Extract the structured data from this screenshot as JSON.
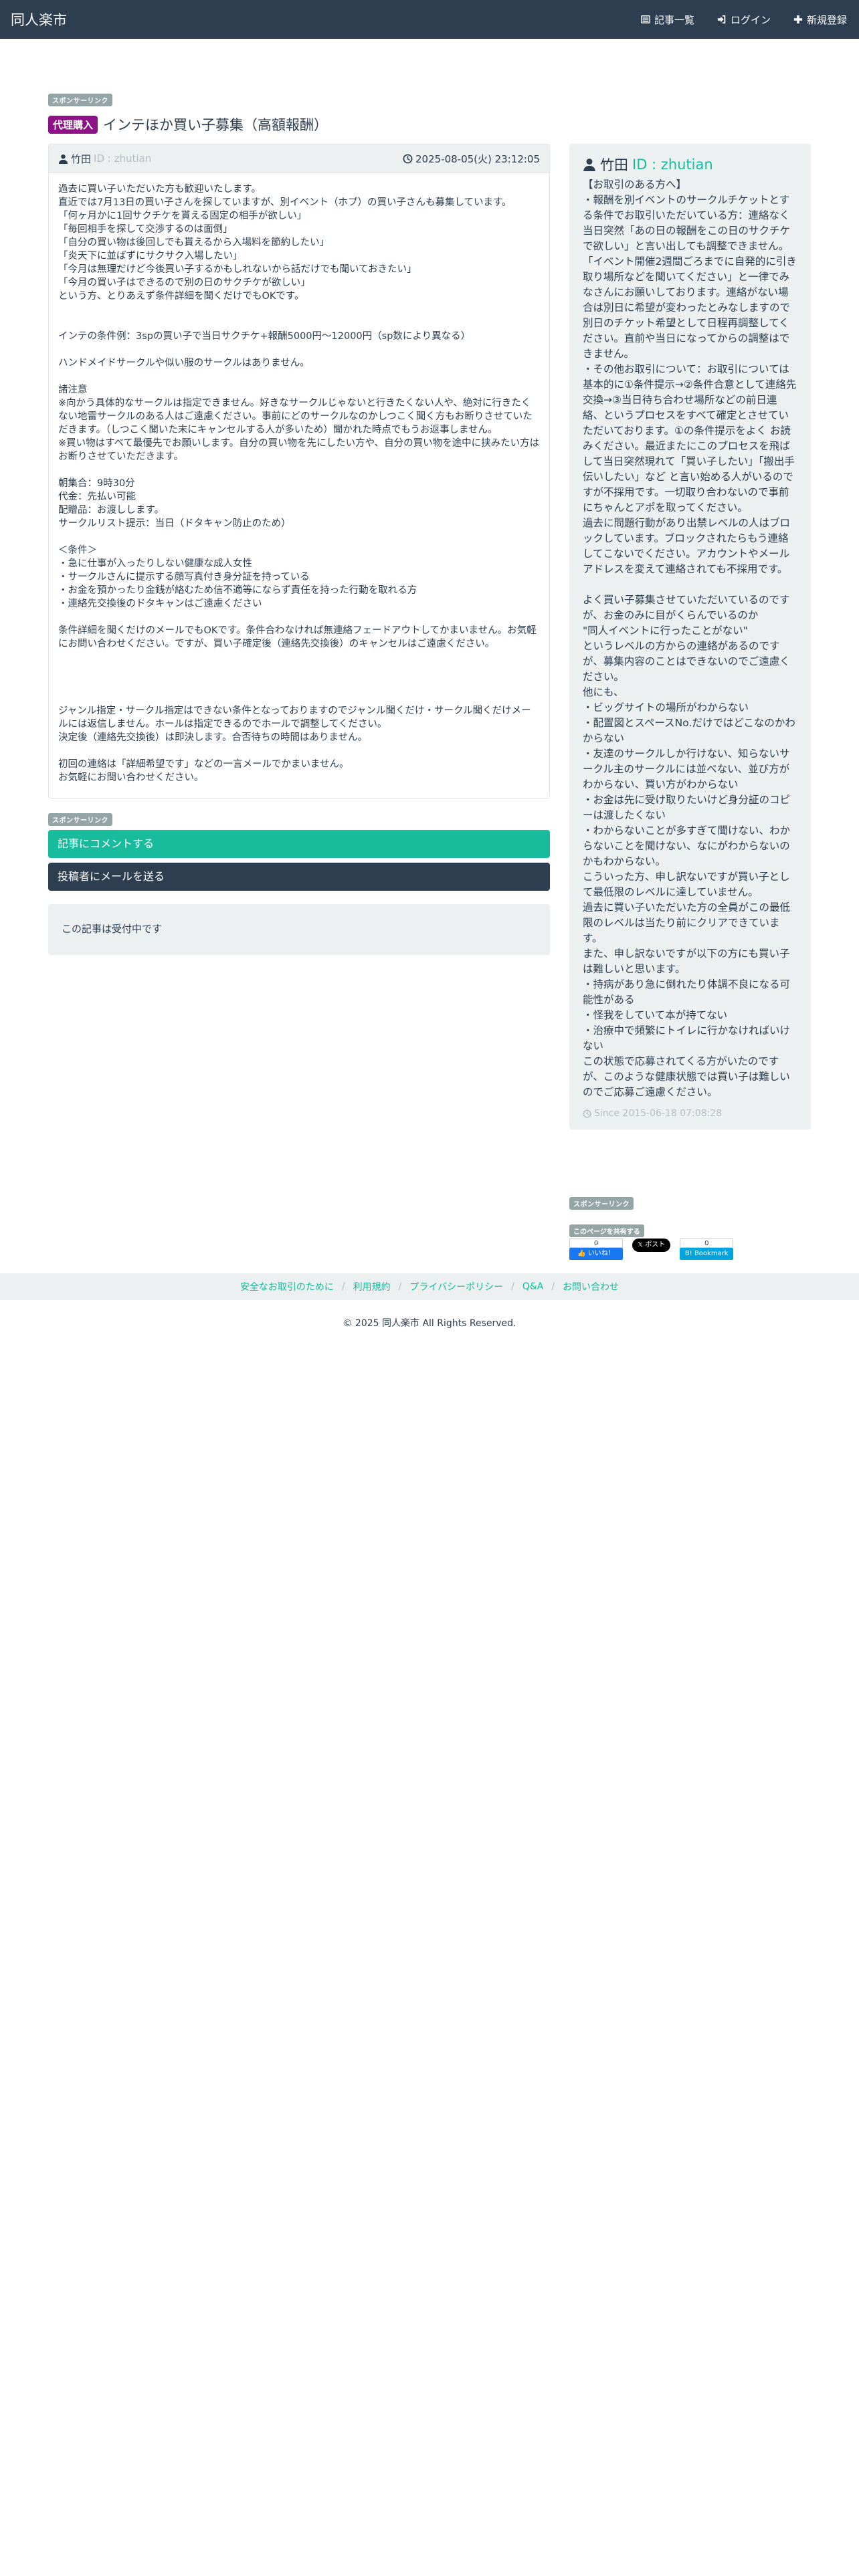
{
  "navbar": {
    "brand": "同人楽市",
    "links": [
      {
        "label": "記事一覧",
        "icon": "list-icon"
      },
      {
        "label": "ログイン",
        "icon": "login-icon"
      },
      {
        "label": "新規登録",
        "icon": "plus-icon"
      }
    ]
  },
  "sponsor_label": "スポンサーリンク",
  "article": {
    "type_badge": "代理購入",
    "title": "インテほか買い子募集（高額報酬）",
    "author": "竹田",
    "author_id": "ID : zhutian",
    "date": "2025-08-05(火) 23:12:05",
    "body": [
      "過去に買い子いただいた方も歓迎いたします。",
      "直近では7月13日の買い子さんを探していますが、別イベント（ホプ）の買い子さんも募集しています。",
      "「何ヶ月かに1回サクチケを貰える固定の相手が欲しい」",
      "「毎回相手を探して交渉するのは面倒」",
      "「自分の買い物は後回しでも貰えるから入場料を節約したい」",
      "「炎天下に並ばずにサクサク入場したい」",
      "「今月は無理だけど今後買い子するかもしれないから話だけでも聞いておきたい」",
      "「今月の買い子はできるので別の日のサクチケが欲しい」",
      "という方、とりあえず条件詳細を聞くだけでもOKです。",
      "",
      "",
      "インテの条件例：3spの買い子で当日サクチケ+報酬5000円～12000円（sp数により異なる）",
      "",
      "ハンドメイドサークルや似い服のサークルはありません。",
      "",
      "諸注意",
      "※向かう具体的なサークルは指定できません。好きなサークルじゃないと行きたくない人や、絶対に行きたくない地雷サークルのある人はご遠慮ください。事前にどのサークルなのかしつこく聞く方もお断りさせていただきます。（しつこく聞いた末にキャンセルする人が多いため）聞かれた時点でもうお返事しません。",
      "※買い物はすべて最優先でお願いします。自分の買い物を先にしたい方や、自分の買い物を途中に挟みたい方はお断りさせていただきます。",
      "",
      "朝集合：9時30分",
      "代金：先払い可能",
      "配贈品：お渡しします。",
      "サークルリスト提示：当日（ドタキャン防止のため）",
      "",
      "＜条件＞",
      "・急に仕事が入ったりしない健康な成人女性",
      "・サークルさんに提示する顔写真付き身分証を持っている",
      "・お金を預かったり金銭が絡むため信不適等にならず責任を持った行動を取れる方",
      "・連絡先交換後のドタキャンはご遠慮ください",
      "",
      "条件詳細を聞くだけのメールでもOKです。条件合わなければ無連絡フェードアウトしてかまいません。お気軽にお問い合わせください。ですが、買い子確定後（連絡先交換後）のキャンセルはご遠慮ください。",
      "",
      "",
      "",
      "",
      "ジャンル指定・サークル指定はできない条件となっておりますのでジャンル聞くだけ・サークル聞くだけメールには返信しません。ホールは指定できるのでホールで調整してください。",
      "決定後（連絡先交換後）は即決します。合否待ちの時間はありません。",
      "",
      "初回の連絡は「詳細希望です」などの一言メールでかまいません。",
      "お気軽にお問い合わせください。"
    ]
  },
  "buttons": {
    "comment": "記事にコメントする",
    "mail": "投稿者にメールを送る"
  },
  "status_text": "この記事は受付中です",
  "profile": {
    "name": "竹田",
    "id": "ID : zhutian",
    "body": [
      "【お取引のある方へ】",
      "・報酬を別イベントのサークルチケットとする条件でお取引いただいている方：連絡なく当日突然「あの日の報酬をこの日のサクチケで欲しい」と言い出しても調整できません。「イベント開催2週間ごろまでに自発的に引き取り場所などを聞いてください」と一律でみなさんにお願いしております。連絡がない場合は別日に希望が変わったとみなしますので別日のチケット希望として日程再調整してください。直前や当日になってからの調整はできません。",
      "・その他お取引について：お取引については基本的に①条件提示→②条件合意として連絡先交換→③当日待ち合わせ場所などの前日連絡、というプロセスをすべて確定とさせていただいております。①の条件提示をよく お読みください。最近またにこのプロセスを飛ばして当日突然現れて「買い子したい」「搬出手伝いしたい」など と言い始める人がいるのですが不採用です。一切取り合わないので事前にちゃんとアポを取ってください。",
      "過去に問題行動があり出禁レベルの人はブロックしています。ブロックされたらもう連絡してこないでください。アカウントやメールアドレスを変えて連絡されても不採用です。",
      "",
      "よく買い子募集させていただいているのですが、お金のみに目がくらんでいるのか",
      "\"同人イベントに行ったことがない\"",
      "というレベルの方からの連絡があるのですが、募集内容のことはできないのでご遠慮ください。",
      "他にも、",
      "・ビッグサイトの場所がわからない",
      "・配置図とスペースNo.だけではどこなのかわからない",
      "・友達のサークルしか行けない、知らないサークル主のサークルには並べない、並び方がわからない、買い方がわからない",
      "・お金は先に受け取りたいけど身分証のコピーは渡したくない",
      "・わからないことが多すぎて聞けない、わからないことを聞けない、なにがわからないのかもわからない。",
      "こういった方、申し訳ないですが買い子として最低限のレベルに達していません。",
      "過去に買い子いただいた方の全員がこの最低限のレベルは当たり前にクリアできています。",
      "また、申し訳ないですが以下の方にも買い子は難しいと思います。",
      "・持病があり急に倒れたり体調不良になる可能性がある",
      "・怪我をしていて本が持てない",
      "・治療中で頻繁にトイレに行かなければいけない",
      "この状態で応募されてくる方がいたのですが、このような健康状態では買い子は難しいのでご応募ご遠慮ください。"
    ],
    "since": "Since 2015-06-18 07:08:28"
  },
  "share": {
    "label": "このページを共有する",
    "fb_count": "0",
    "fb_label": "いいね！",
    "x_label": "ポスト",
    "hb_count": "0",
    "hb_label": "Bookmark"
  },
  "footer": {
    "links": [
      "安全なお取引のために",
      "利用規約",
      "プライバシーポリシー",
      "Q&A",
      "お問い合わせ"
    ],
    "copyright": "© 2025 同人楽市 All Rights Reserved."
  },
  "colors": {
    "navbar": "#2c3e50",
    "accent": "#18bc9c",
    "badge": "#8e1187",
    "panel": "#ecf0f1"
  }
}
